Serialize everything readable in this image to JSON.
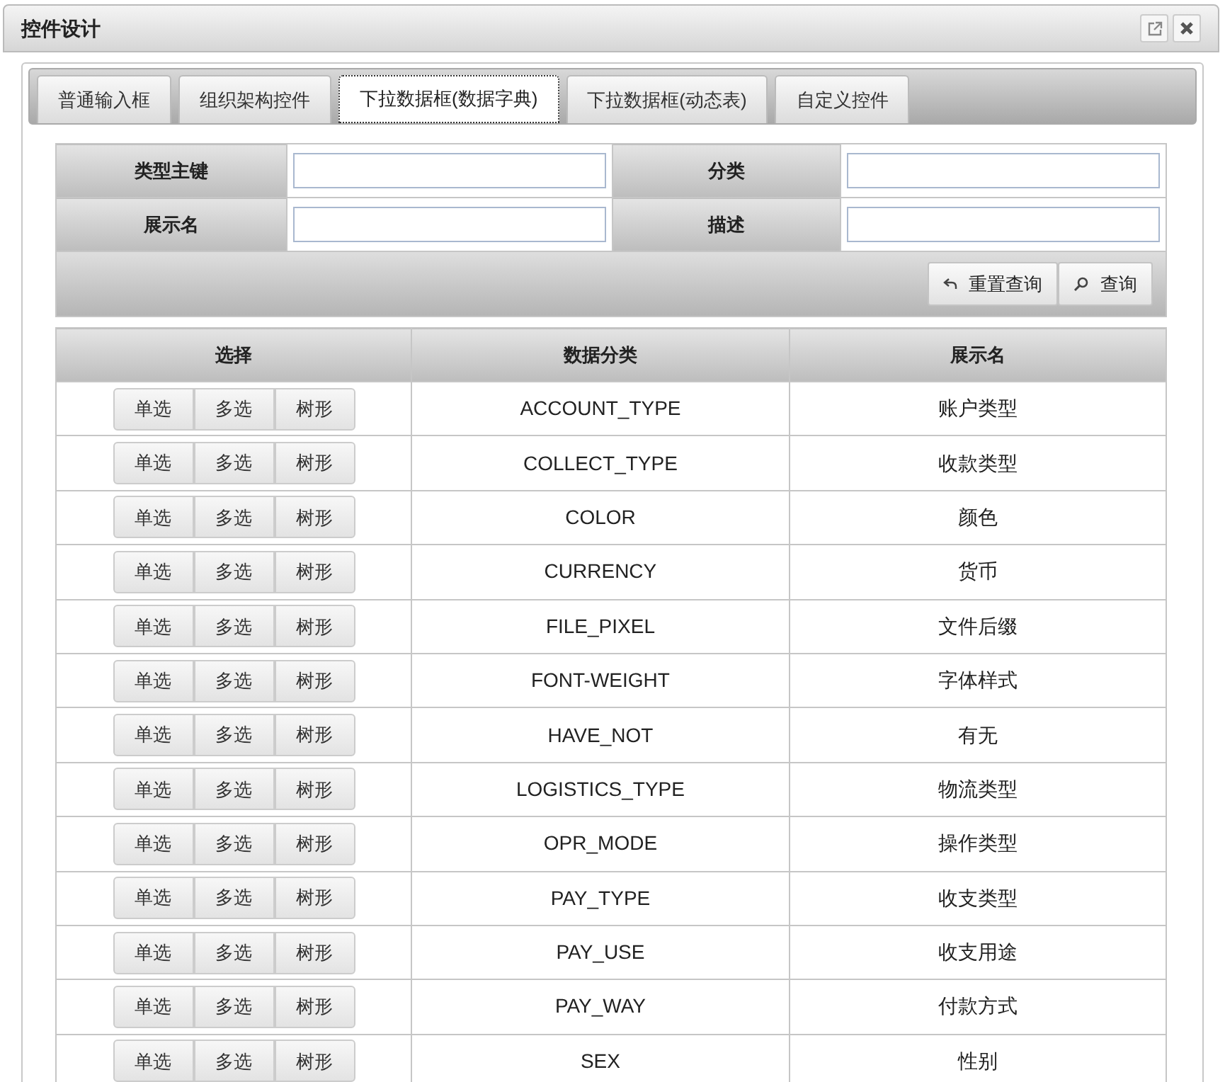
{
  "window": {
    "title": "控件设计"
  },
  "tabs": [
    {
      "label": "普通输入框",
      "selected": false
    },
    {
      "label": "组织架构控件",
      "selected": false
    },
    {
      "label": "下拉数据框(数据字典)",
      "selected": true
    },
    {
      "label": "下拉数据框(动态表)",
      "selected": false
    },
    {
      "label": "自定义控件",
      "selected": false
    }
  ],
  "search": {
    "fields": [
      {
        "label": "类型主键"
      },
      {
        "label": "分类"
      },
      {
        "label": "展示名"
      },
      {
        "label": "描述"
      }
    ],
    "buttons": [
      {
        "label": "重置查询",
        "kind": "reset"
      },
      {
        "label": "查询",
        "kind": "search"
      }
    ]
  },
  "table": {
    "columns": [
      "选择",
      "数据分类",
      "展示名"
    ],
    "rows": [
      {
        "buttons": [
          "单选",
          "多选",
          "树形"
        ],
        "category": "ACCOUNT_TYPE",
        "display_name": "账户类型"
      },
      {
        "buttons": [
          "单选",
          "多选",
          "树形"
        ],
        "category": "COLLECT_TYPE",
        "display_name": "收款类型"
      },
      {
        "buttons": [
          "单选",
          "多选",
          "树形"
        ],
        "category": "COLOR",
        "display_name": "颜色"
      },
      {
        "buttons": [
          "单选",
          "多选",
          "树形"
        ],
        "category": "CURRENCY",
        "display_name": "货币"
      },
      {
        "buttons": [
          "单选",
          "多选",
          "树形"
        ],
        "category": "FILE_PIXEL",
        "display_name": "文件后缀"
      },
      {
        "buttons": [
          "单选",
          "多选",
          "树形"
        ],
        "category": "FONT-WEIGHT",
        "display_name": "字体样式"
      },
      {
        "buttons": [
          "单选",
          "多选",
          "树形"
        ],
        "category": "HAVE_NOT",
        "display_name": "有无"
      },
      {
        "buttons": [
          "单选",
          "多选",
          "树形"
        ],
        "category": "LOGISTICS_TYPE",
        "display_name": "物流类型"
      },
      {
        "buttons": [
          "单选",
          "多选",
          "树形"
        ],
        "category": "OPR_MODE",
        "display_name": "操作类型"
      },
      {
        "buttons": [
          "单选",
          "多选",
          "树形"
        ],
        "category": "PAY_TYPE",
        "display_name": "收支类型"
      },
      {
        "buttons": [
          "单选",
          "多选",
          "树形"
        ],
        "category": "PAY_USE",
        "display_name": "收支用途"
      },
      {
        "buttons": [
          "单选",
          "多选",
          "树形"
        ],
        "category": "PAY_WAY",
        "display_name": "付款方式"
      },
      {
        "buttons": [
          "单选",
          "多选",
          "树形"
        ],
        "category": "SEX",
        "display_name": "性别"
      }
    ]
  }
}
